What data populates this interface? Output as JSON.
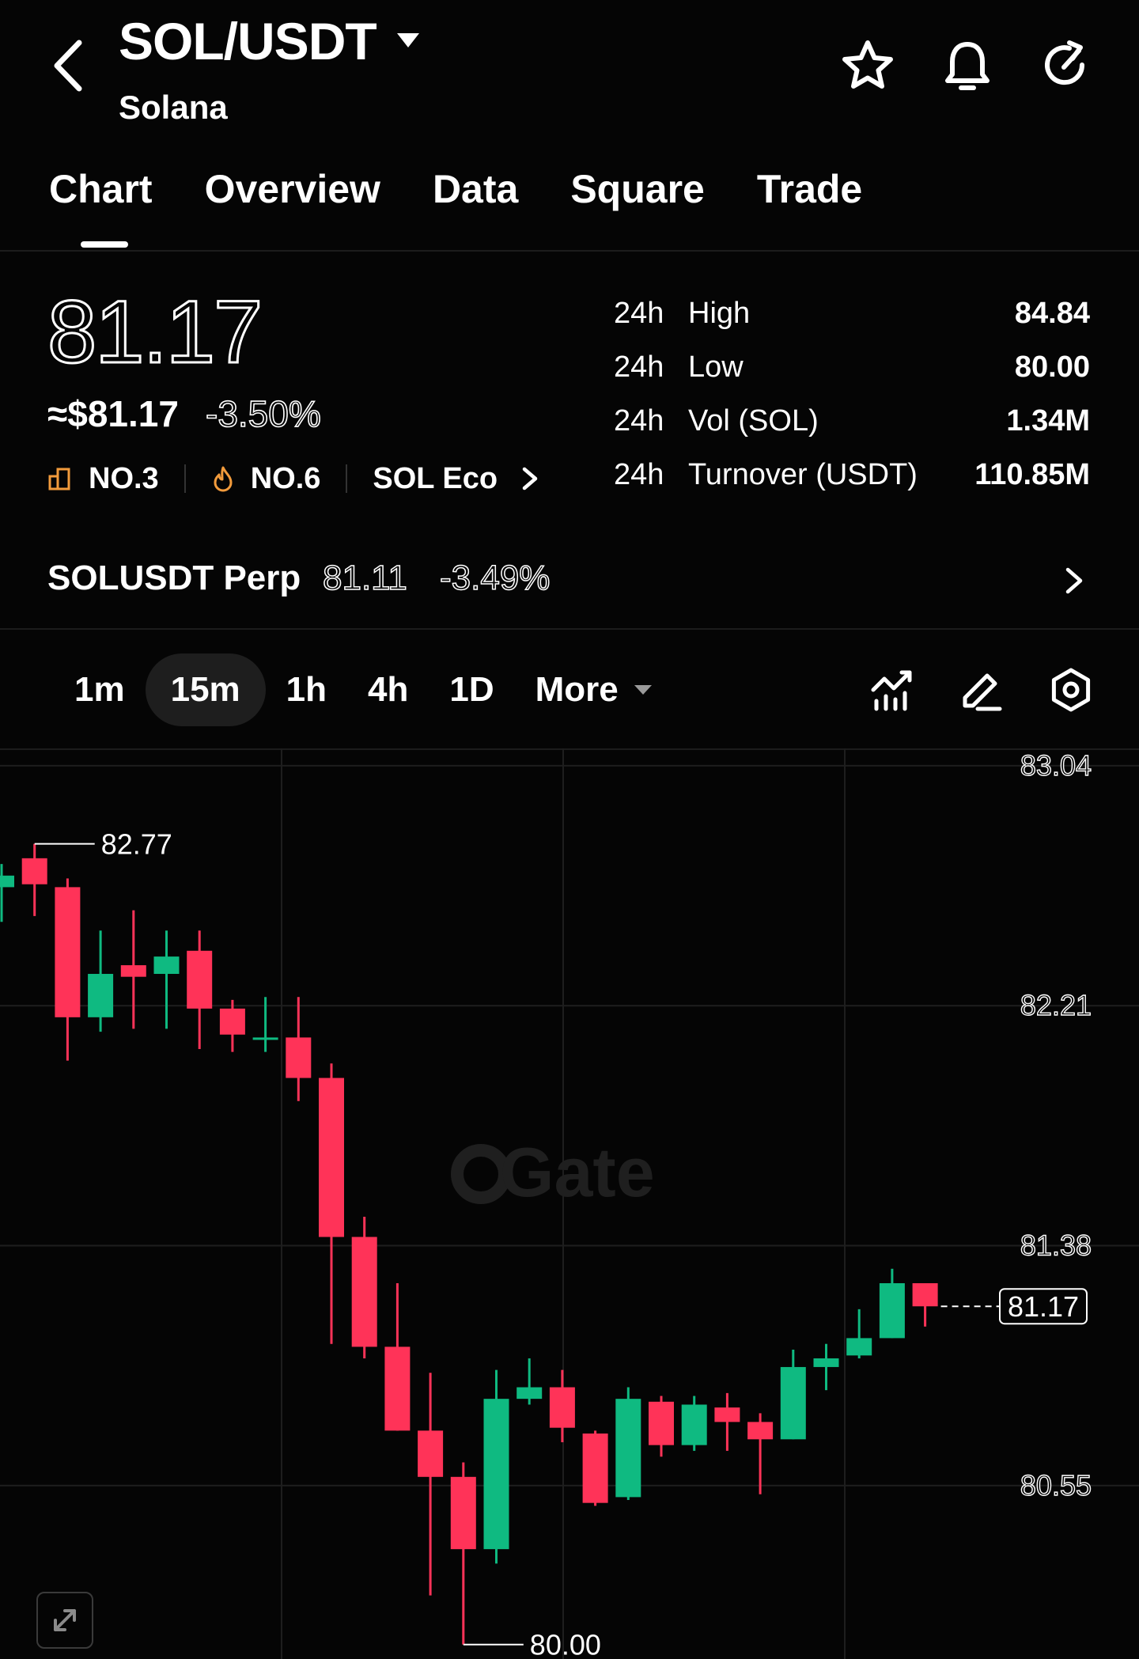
{
  "header": {
    "pair": "SOL/USDT",
    "name": "Solana",
    "icons": [
      "back-arrow-icon",
      "caret-down-icon",
      "star-icon",
      "bell-icon",
      "share-icon"
    ]
  },
  "tabs": [
    {
      "label": "Chart",
      "active": true
    },
    {
      "label": "Overview",
      "active": false
    },
    {
      "label": "Data",
      "active": false
    },
    {
      "label": "Square",
      "active": false
    },
    {
      "label": "Trade",
      "active": false
    }
  ],
  "price": {
    "last": "81.17",
    "usd": "≈$81.17",
    "change_pct": "-3.50%"
  },
  "tags": {
    "rank_market": "NO.3",
    "rank_hot": "NO.6",
    "eco": "SOL Eco"
  },
  "stats": [
    {
      "period": "24h",
      "label": "High",
      "value": "84.84"
    },
    {
      "period": "24h",
      "label": "Low",
      "value": "80.00"
    },
    {
      "period": "24h",
      "label": "Vol (SOL)",
      "value": "1.34M"
    },
    {
      "period": "24h",
      "label": "Turnover (USDT)",
      "value": "110.85M"
    }
  ],
  "perp": {
    "name": "SOLUSDT Perp",
    "price": "81.11",
    "change_pct": "-3.49%"
  },
  "timeframes": [
    {
      "label": "1m",
      "active": false
    },
    {
      "label": "15m",
      "active": true
    },
    {
      "label": "1h",
      "active": false
    },
    {
      "label": "4h",
      "active": false
    },
    {
      "label": "1D",
      "active": false
    }
  ],
  "more_label": "More",
  "toolbar_icons": [
    "indicator-icon",
    "draw-icon",
    "settings-icon"
  ],
  "colors": {
    "up": "#0fba81",
    "down": "#ff3358",
    "background": "#050505",
    "grid": "#1e1e1e"
  },
  "chart_data": {
    "type": "candlestick",
    "interval": "15m",
    "y_ticks": [
      "83.04",
      "82.21",
      "81.38",
      "80.55"
    ],
    "ylim": [
      79.95,
      83.1
    ],
    "high_label": "82.77",
    "low_label": "80.00",
    "current_label": "81.17",
    "watermark": "Gate",
    "candles": [
      {
        "o": 82.62,
        "h": 82.7,
        "l": 82.5,
        "c": 82.66
      },
      {
        "o": 82.72,
        "h": 82.77,
        "l": 82.52,
        "c": 82.63
      },
      {
        "o": 82.62,
        "h": 82.65,
        "l": 82.02,
        "c": 82.17
      },
      {
        "o": 82.17,
        "h": 82.47,
        "l": 82.12,
        "c": 82.32
      },
      {
        "o": 82.35,
        "h": 82.54,
        "l": 82.13,
        "c": 82.31
      },
      {
        "o": 82.32,
        "h": 82.47,
        "l": 82.13,
        "c": 82.38
      },
      {
        "o": 82.4,
        "h": 82.47,
        "l": 82.06,
        "c": 82.2
      },
      {
        "o": 82.2,
        "h": 82.23,
        "l": 82.05,
        "c": 82.11
      },
      {
        "o": 82.1,
        "h": 82.24,
        "l": 82.05,
        "c": 82.1
      },
      {
        "o": 82.1,
        "h": 82.24,
        "l": 81.88,
        "c": 81.96
      },
      {
        "o": 81.96,
        "h": 82.01,
        "l": 81.04,
        "c": 81.41
      },
      {
        "o": 81.41,
        "h": 81.48,
        "l": 80.99,
        "c": 81.03
      },
      {
        "o": 81.03,
        "h": 81.25,
        "l": 80.74,
        "c": 80.74
      },
      {
        "o": 80.74,
        "h": 80.94,
        "l": 80.17,
        "c": 80.58
      },
      {
        "o": 80.58,
        "h": 80.63,
        "l": 80.0,
        "c": 80.33
      },
      {
        "o": 80.33,
        "h": 80.95,
        "l": 80.28,
        "c": 80.85
      },
      {
        "o": 80.85,
        "h": 80.99,
        "l": 80.83,
        "c": 80.89
      },
      {
        "o": 80.89,
        "h": 80.95,
        "l": 80.7,
        "c": 80.75
      },
      {
        "o": 80.73,
        "h": 80.74,
        "l": 80.48,
        "c": 80.49
      },
      {
        "o": 80.51,
        "h": 80.89,
        "l": 80.5,
        "c": 80.85
      },
      {
        "o": 80.84,
        "h": 80.86,
        "l": 80.65,
        "c": 80.69
      },
      {
        "o": 80.69,
        "h": 80.86,
        "l": 80.67,
        "c": 80.83
      },
      {
        "o": 80.82,
        "h": 80.87,
        "l": 80.67,
        "c": 80.77
      },
      {
        "o": 80.77,
        "h": 80.8,
        "l": 80.52,
        "c": 80.71
      },
      {
        "o": 80.71,
        "h": 81.02,
        "l": 80.71,
        "c": 80.96
      },
      {
        "o": 80.96,
        "h": 81.04,
        "l": 80.88,
        "c": 80.99
      },
      {
        "o": 81.0,
        "h": 81.16,
        "l": 80.99,
        "c": 81.06
      },
      {
        "o": 81.06,
        "h": 81.3,
        "l": 81.06,
        "c": 81.25
      },
      {
        "o": 81.25,
        "h": 81.25,
        "l": 81.1,
        "c": 81.17
      }
    ]
  }
}
